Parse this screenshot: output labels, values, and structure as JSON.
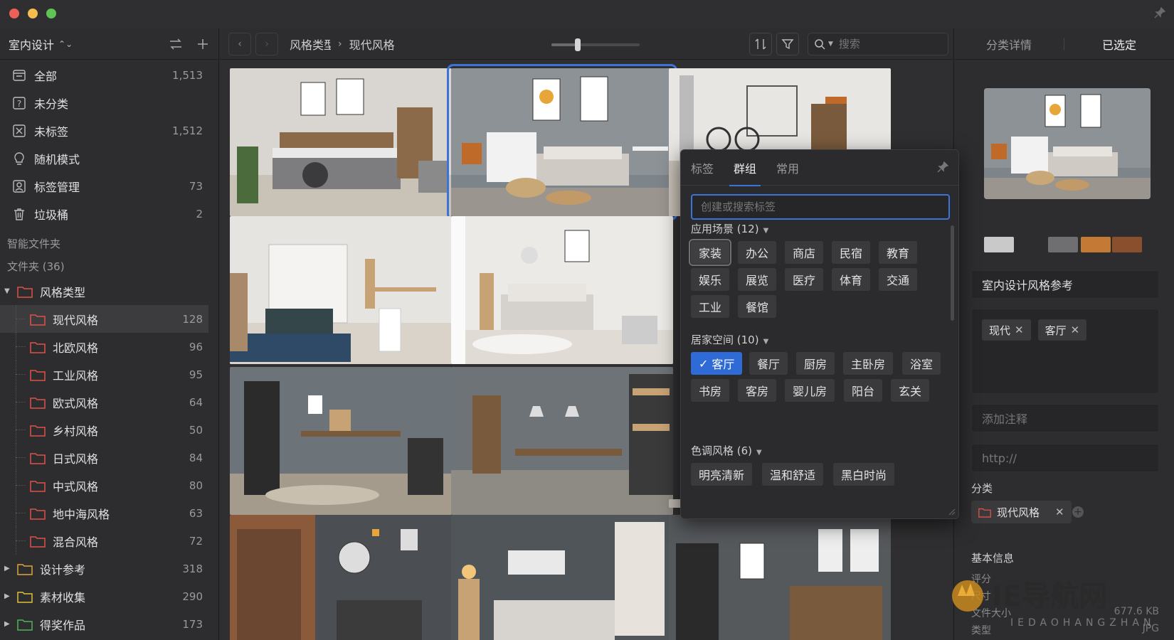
{
  "sidebar": {
    "library_title": "室内设计",
    "nav": [
      {
        "label": "全部",
        "count": "1,513"
      },
      {
        "label": "未分类",
        "count": ""
      },
      {
        "label": "未标签",
        "count": "1,512"
      },
      {
        "label": "随机模式",
        "count": ""
      },
      {
        "label": "标签管理",
        "count": "73"
      },
      {
        "label": "垃圾桶",
        "count": "2"
      }
    ],
    "smart_folders_label": "智能文件夹",
    "folders_label": "文件夹 (36)",
    "style_folder": {
      "label": "风格类型"
    },
    "style_children": [
      {
        "label": "现代风格",
        "count": "128"
      },
      {
        "label": "北欧风格",
        "count": "96"
      },
      {
        "label": "工业风格",
        "count": "95"
      },
      {
        "label": "欧式风格",
        "count": "64"
      },
      {
        "label": "乡村风格",
        "count": "50"
      },
      {
        "label": "日式风格",
        "count": "84"
      },
      {
        "label": "中式风格",
        "count": "80"
      },
      {
        "label": "地中海风格",
        "count": "63"
      },
      {
        "label": "混合风格",
        "count": "72"
      }
    ],
    "other_folders": [
      {
        "label": "设计参考",
        "count": "318"
      },
      {
        "label": "素材收集",
        "count": "290"
      },
      {
        "label": "得奖作品",
        "count": "173"
      }
    ]
  },
  "toolbar": {
    "breadcrumb_parent": "风格类型",
    "breadcrumb_current": "现代风格",
    "search_placeholder": "搜索",
    "zoom_level": 0.3
  },
  "right_panel": {
    "tab_details": "分类详情",
    "tab_selected": "已选定",
    "swatch_colors": [
      "#c9c9c9",
      "#2d2d2f",
      "#6f6f72",
      "#c47a35",
      "#8a4f2c"
    ],
    "title": "室内设计风格参考",
    "tags": [
      {
        "label": "现代",
        "remove": "✕"
      },
      {
        "label": "客厅",
        "remove": "✕"
      }
    ],
    "note_placeholder": "添加注释",
    "url_placeholder": "http://",
    "category_label": "分类",
    "category_folder": "现代风格",
    "category_remove": "✕",
    "basic_info_label": "基本信息",
    "info": [
      {
        "key": "评分",
        "value": ""
      },
      {
        "key": "尺寸",
        "value": ""
      },
      {
        "key": "文件大小",
        "value": "677.6 KB"
      },
      {
        "key": "类型",
        "value": "JPG"
      }
    ]
  },
  "tag_popover": {
    "tabs": [
      "标签",
      "群组",
      "常用"
    ],
    "active_tab": "群组",
    "search_placeholder": "创建或搜索标签",
    "groups": [
      {
        "title": "应用场景 (12)",
        "tags": [
          "家装",
          "办公",
          "商店",
          "民宿",
          "教育",
          "娱乐",
          "展览",
          "医疗",
          "体育",
          "交通",
          "工业",
          "餐馆"
        ]
      },
      {
        "title": "居家空间 (10)",
        "tags": [
          "客厅",
          "餐厅",
          "厨房",
          "主卧房",
          "浴室",
          "书房",
          "客房",
          "婴儿房",
          "阳台",
          "玄关"
        ]
      },
      {
        "title": "色调风格 (6)",
        "tags": [
          "明亮清新",
          "温和舒适",
          "黑白时尚"
        ]
      }
    ],
    "checked_tag": "客厅",
    "focused_tag": "家装"
  },
  "watermark": {
    "main": "IE导航网",
    "sub": "IEDAOHANGZHAN"
  }
}
